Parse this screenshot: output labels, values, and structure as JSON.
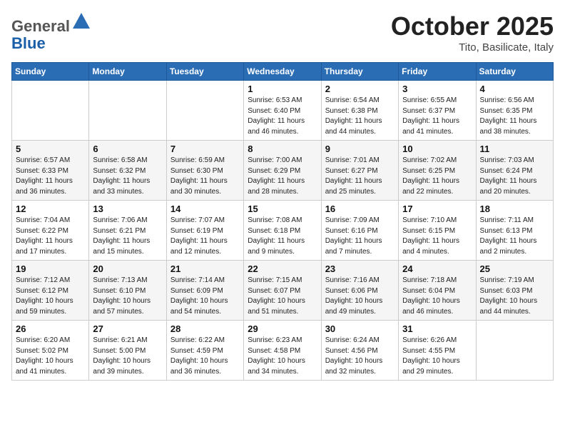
{
  "header": {
    "logo_general": "General",
    "logo_blue": "Blue",
    "month_title": "October 2025",
    "location": "Tito, Basilicate, Italy"
  },
  "weekdays": [
    "Sunday",
    "Monday",
    "Tuesday",
    "Wednesday",
    "Thursday",
    "Friday",
    "Saturday"
  ],
  "weeks": [
    [
      null,
      null,
      null,
      {
        "day": 1,
        "sunrise": "6:53 AM",
        "sunset": "6:40 PM",
        "daylight": "11 hours and 46 minutes."
      },
      {
        "day": 2,
        "sunrise": "6:54 AM",
        "sunset": "6:38 PM",
        "daylight": "11 hours and 44 minutes."
      },
      {
        "day": 3,
        "sunrise": "6:55 AM",
        "sunset": "6:37 PM",
        "daylight": "11 hours and 41 minutes."
      },
      {
        "day": 4,
        "sunrise": "6:56 AM",
        "sunset": "6:35 PM",
        "daylight": "11 hours and 38 minutes."
      }
    ],
    [
      {
        "day": 5,
        "sunrise": "6:57 AM",
        "sunset": "6:33 PM",
        "daylight": "11 hours and 36 minutes."
      },
      {
        "day": 6,
        "sunrise": "6:58 AM",
        "sunset": "6:32 PM",
        "daylight": "11 hours and 33 minutes."
      },
      {
        "day": 7,
        "sunrise": "6:59 AM",
        "sunset": "6:30 PM",
        "daylight": "11 hours and 30 minutes."
      },
      {
        "day": 8,
        "sunrise": "7:00 AM",
        "sunset": "6:29 PM",
        "daylight": "11 hours and 28 minutes."
      },
      {
        "day": 9,
        "sunrise": "7:01 AM",
        "sunset": "6:27 PM",
        "daylight": "11 hours and 25 minutes."
      },
      {
        "day": 10,
        "sunrise": "7:02 AM",
        "sunset": "6:25 PM",
        "daylight": "11 hours and 22 minutes."
      },
      {
        "day": 11,
        "sunrise": "7:03 AM",
        "sunset": "6:24 PM",
        "daylight": "11 hours and 20 minutes."
      }
    ],
    [
      {
        "day": 12,
        "sunrise": "7:04 AM",
        "sunset": "6:22 PM",
        "daylight": "11 hours and 17 minutes."
      },
      {
        "day": 13,
        "sunrise": "7:06 AM",
        "sunset": "6:21 PM",
        "daylight": "11 hours and 15 minutes."
      },
      {
        "day": 14,
        "sunrise": "7:07 AM",
        "sunset": "6:19 PM",
        "daylight": "11 hours and 12 minutes."
      },
      {
        "day": 15,
        "sunrise": "7:08 AM",
        "sunset": "6:18 PM",
        "daylight": "11 hours and 9 minutes."
      },
      {
        "day": 16,
        "sunrise": "7:09 AM",
        "sunset": "6:16 PM",
        "daylight": "11 hours and 7 minutes."
      },
      {
        "day": 17,
        "sunrise": "7:10 AM",
        "sunset": "6:15 PM",
        "daylight": "11 hours and 4 minutes."
      },
      {
        "day": 18,
        "sunrise": "7:11 AM",
        "sunset": "6:13 PM",
        "daylight": "11 hours and 2 minutes."
      }
    ],
    [
      {
        "day": 19,
        "sunrise": "7:12 AM",
        "sunset": "6:12 PM",
        "daylight": "10 hours and 59 minutes."
      },
      {
        "day": 20,
        "sunrise": "7:13 AM",
        "sunset": "6:10 PM",
        "daylight": "10 hours and 57 minutes."
      },
      {
        "day": 21,
        "sunrise": "7:14 AM",
        "sunset": "6:09 PM",
        "daylight": "10 hours and 54 minutes."
      },
      {
        "day": 22,
        "sunrise": "7:15 AM",
        "sunset": "6:07 PM",
        "daylight": "10 hours and 51 minutes."
      },
      {
        "day": 23,
        "sunrise": "7:16 AM",
        "sunset": "6:06 PM",
        "daylight": "10 hours and 49 minutes."
      },
      {
        "day": 24,
        "sunrise": "7:18 AM",
        "sunset": "6:04 PM",
        "daylight": "10 hours and 46 minutes."
      },
      {
        "day": 25,
        "sunrise": "7:19 AM",
        "sunset": "6:03 PM",
        "daylight": "10 hours and 44 minutes."
      }
    ],
    [
      {
        "day": 26,
        "sunrise": "6:20 AM",
        "sunset": "5:02 PM",
        "daylight": "10 hours and 41 minutes."
      },
      {
        "day": 27,
        "sunrise": "6:21 AM",
        "sunset": "5:00 PM",
        "daylight": "10 hours and 39 minutes."
      },
      {
        "day": 28,
        "sunrise": "6:22 AM",
        "sunset": "4:59 PM",
        "daylight": "10 hours and 36 minutes."
      },
      {
        "day": 29,
        "sunrise": "6:23 AM",
        "sunset": "4:58 PM",
        "daylight": "10 hours and 34 minutes."
      },
      {
        "day": 30,
        "sunrise": "6:24 AM",
        "sunset": "4:56 PM",
        "daylight": "10 hours and 32 minutes."
      },
      {
        "day": 31,
        "sunrise": "6:26 AM",
        "sunset": "4:55 PM",
        "daylight": "10 hours and 29 minutes."
      },
      null
    ]
  ]
}
